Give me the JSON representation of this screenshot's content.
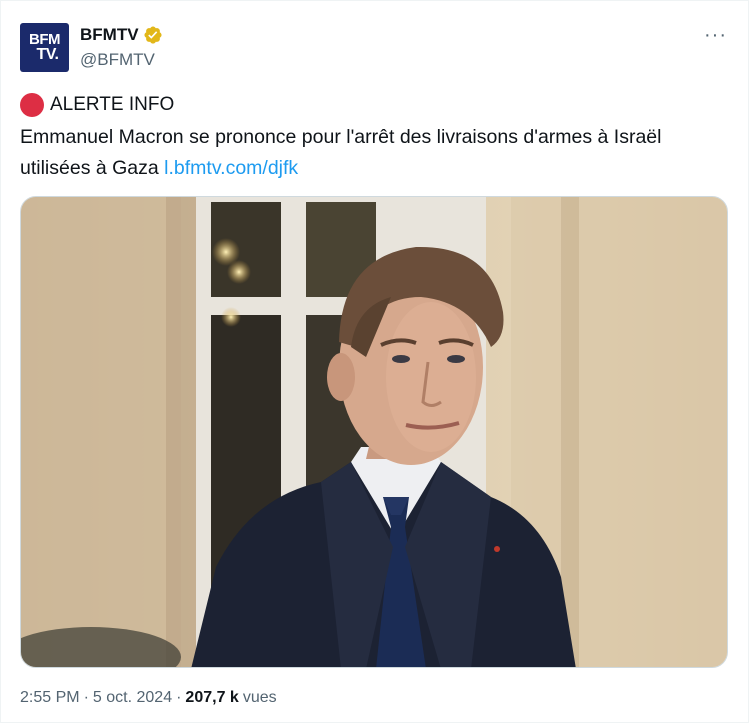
{
  "account": {
    "avatar_line1": "BFM",
    "avatar_line2": "TV.",
    "display_name": "BFMTV",
    "handle": "@BFMTV"
  },
  "more_label": "···",
  "tweet": {
    "alert_label": "ALERTE INFO",
    "text": "Emmanuel Macron se prononce pour l'arrêt des livraisons d'armes à Israël utilisées à Gaza",
    "link": "l.bfmtv.com/djfk"
  },
  "footer": {
    "time": "2:55 PM",
    "sep1": "·",
    "date": "5 oct. 2024",
    "sep2": "·",
    "views_count": "207,7 k",
    "views_label": "vues"
  },
  "colors": {
    "link": "#1d9bf0",
    "secondary_text": "#536471",
    "alert_dot": "#dd2e44",
    "verified_badge": "#e2b719"
  }
}
